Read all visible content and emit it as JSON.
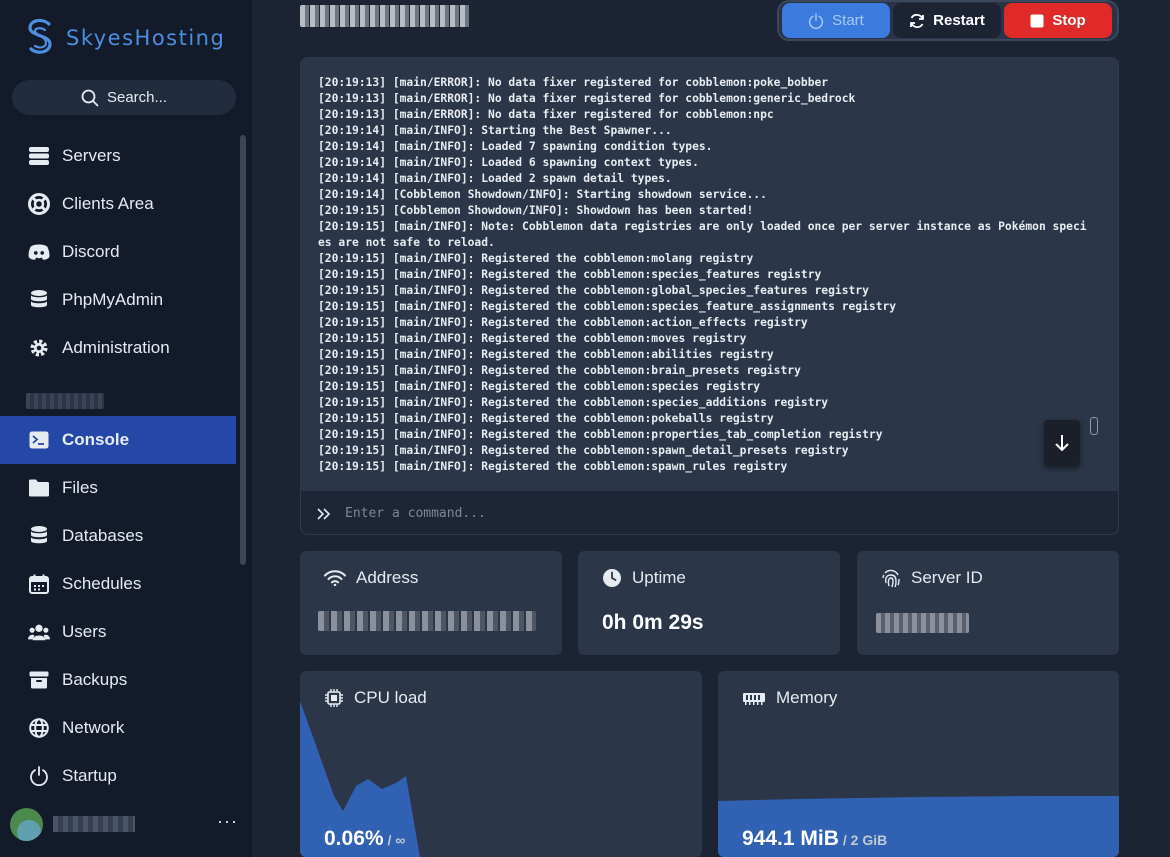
{
  "brand": {
    "name": "SkyesHosting"
  },
  "search": {
    "label": "Search..."
  },
  "sidebar": {
    "top_items": [
      {
        "label": "Servers",
        "icon": "servers-icon"
      },
      {
        "label": "Clients Area",
        "icon": "lifebuoy-icon"
      },
      {
        "label": "Discord",
        "icon": "discord-icon"
      },
      {
        "label": "PhpMyAdmin",
        "icon": "database-icon"
      },
      {
        "label": "Administration",
        "icon": "gear-icon"
      }
    ],
    "server_items": [
      {
        "label": "Console",
        "icon": "terminal-icon",
        "active": true
      },
      {
        "label": "Files",
        "icon": "folder-icon"
      },
      {
        "label": "Databases",
        "icon": "database-icon"
      },
      {
        "label": "Schedules",
        "icon": "calendar-icon"
      },
      {
        "label": "Users",
        "icon": "users-icon"
      },
      {
        "label": "Backups",
        "icon": "archive-icon"
      },
      {
        "label": "Network",
        "icon": "globe-icon"
      },
      {
        "label": "Startup",
        "icon": "power-icon"
      }
    ],
    "more": "···"
  },
  "power": {
    "start": "Start",
    "restart": "Restart",
    "stop": "Stop"
  },
  "console": {
    "lines": [
      "[20:19:13] [main/ERROR]: No data fixer registered for cobblemon:poke_bobber",
      "[20:19:13] [main/ERROR]: No data fixer registered for cobblemon:generic_bedrock",
      "[20:19:13] [main/ERROR]: No data fixer registered for cobblemon:npc",
      "[20:19:14] [main/INFO]: Starting the Best Spawner...",
      "[20:19:14] [main/INFO]: Loaded 7 spawning condition types.",
      "[20:19:14] [main/INFO]: Loaded 6 spawning context types.",
      "[20:19:14] [main/INFO]: Loaded 2 spawn detail types.",
      "[20:19:14] [Cobblemon Showdown/INFO]: Starting showdown service...",
      "[20:19:15] [Cobblemon Showdown/INFO]: Showdown has been started!",
      "[20:19:15] [main/INFO]: Note: Cobblemon data registries are only loaded once per server instance as Pokémon species are not safe to reload.",
      "[20:19:15] [main/INFO]: Registered the cobblemon:molang registry",
      "[20:19:15] [main/INFO]: Registered the cobblemon:species_features registry",
      "[20:19:15] [main/INFO]: Registered the cobblemon:global_species_features registry",
      "[20:19:15] [main/INFO]: Registered the cobblemon:species_feature_assignments registry",
      "[20:19:15] [main/INFO]: Registered the cobblemon:action_effects registry",
      "[20:19:15] [main/INFO]: Registered the cobblemon:moves registry",
      "[20:19:15] [main/INFO]: Registered the cobblemon:abilities registry",
      "[20:19:15] [main/INFO]: Registered the cobblemon:brain_presets registry",
      "[20:19:15] [main/INFO]: Registered the cobblemon:species registry",
      "[20:19:15] [main/INFO]: Registered the cobblemon:species_additions registry",
      "[20:19:15] [main/INFO]: Registered the cobblemon:pokeballs registry",
      "[20:19:15] [main/INFO]: Registered the cobblemon:properties_tab_completion registry",
      "[20:19:15] [main/INFO]: Registered the cobblemon:spawn_detail_presets registry",
      "[20:19:15] [main/INFO]: Registered the cobblemon:spawn_rules registry"
    ],
    "input_placeholder": "Enter a command..."
  },
  "stats": {
    "address": {
      "title": "Address"
    },
    "uptime": {
      "title": "Uptime",
      "value": "0h 0m 29s"
    },
    "server_id": {
      "title": "Server ID"
    }
  },
  "graphs": {
    "cpu": {
      "title": "CPU load",
      "value": "0.06%",
      "limit": "/ ∞"
    },
    "memory": {
      "title": "Memory",
      "value": "944.1 MiB",
      "limit": "/ 2 GiB"
    }
  },
  "colors": {
    "accent": "#2547a8",
    "start": "#3b7bde",
    "stop": "#e02a2a",
    "graph": "#3161b3"
  }
}
